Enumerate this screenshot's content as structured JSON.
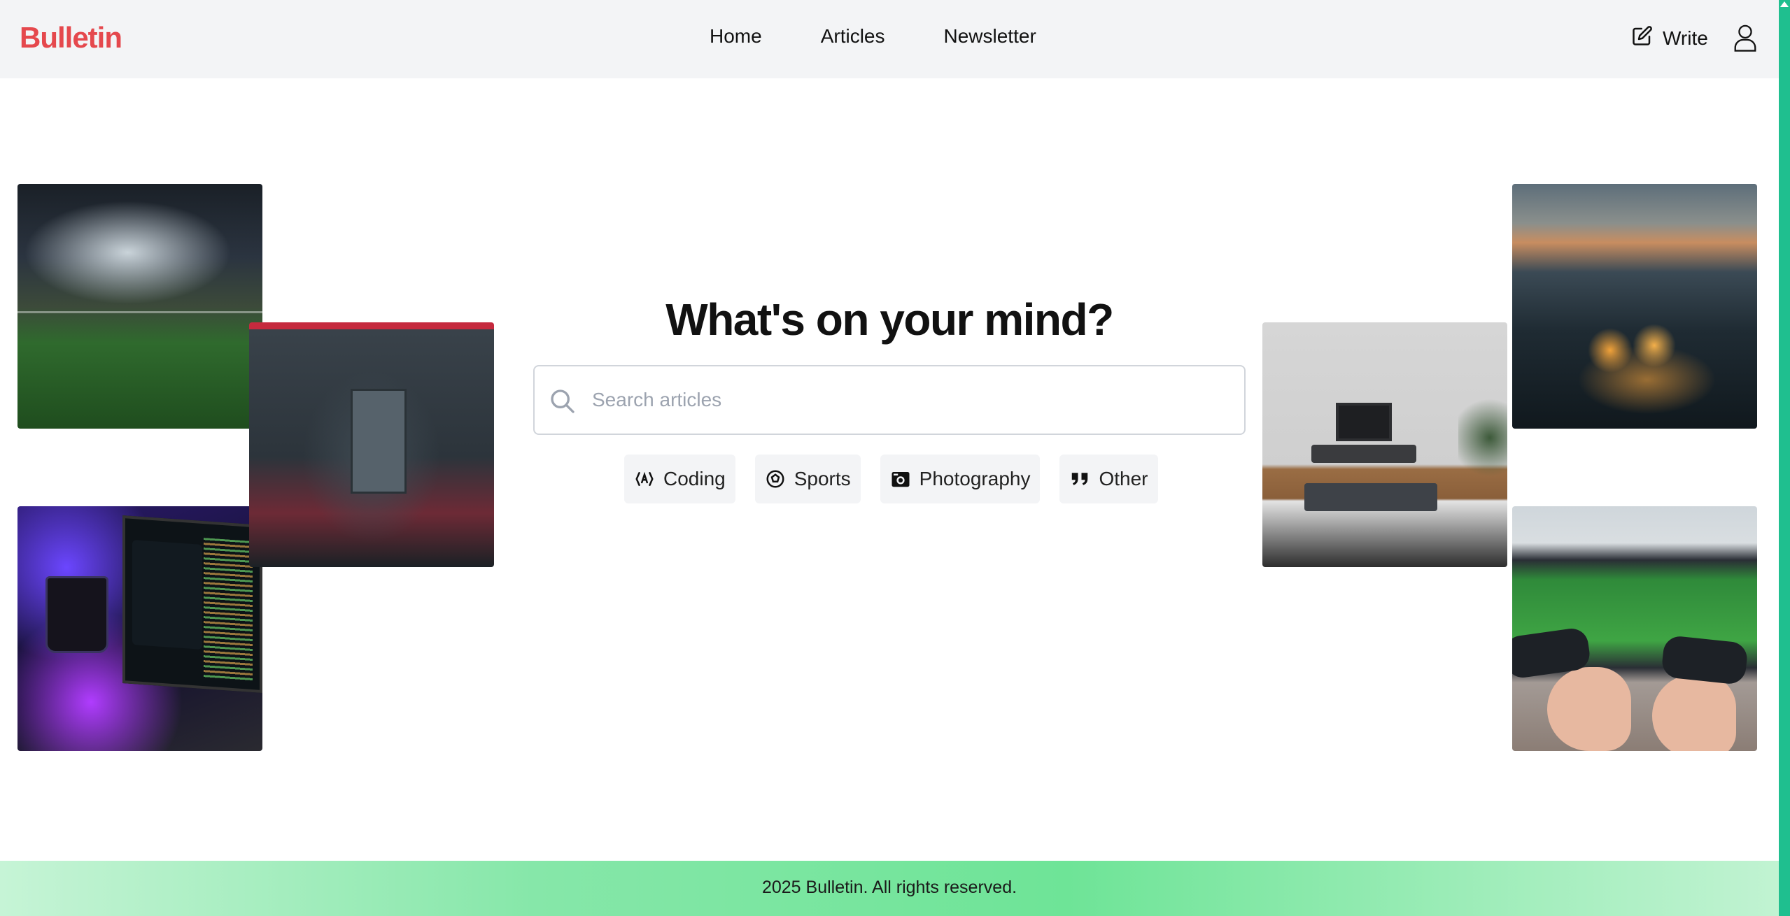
{
  "header": {
    "brand": "Bulletin",
    "nav": [
      "Home",
      "Articles",
      "Newsletter"
    ],
    "write_label": "Write"
  },
  "hero": {
    "title": "What's on your mind?",
    "search_placeholder": "Search articles",
    "categories": [
      {
        "label": "Coding",
        "icon": "code-icon"
      },
      {
        "label": "Sports",
        "icon": "ball-icon"
      },
      {
        "label": "Photography",
        "icon": "camera-icon"
      },
      {
        "label": "Other",
        "icon": "quote-icon"
      }
    ]
  },
  "tiles": [
    {
      "name": "stadium-photo"
    },
    {
      "name": "bedroom-photo"
    },
    {
      "name": "laptop-code-photo"
    },
    {
      "name": "desk-setup-photo"
    },
    {
      "name": "balloon-valley-photo"
    },
    {
      "name": "gaming-photo"
    }
  ],
  "footer": {
    "text": "2025 Bulletin. All rights reserved."
  },
  "colors": {
    "brand": "#e5484d",
    "footer_green": "#6ee497",
    "scrollbar": "#1fbf8f"
  }
}
